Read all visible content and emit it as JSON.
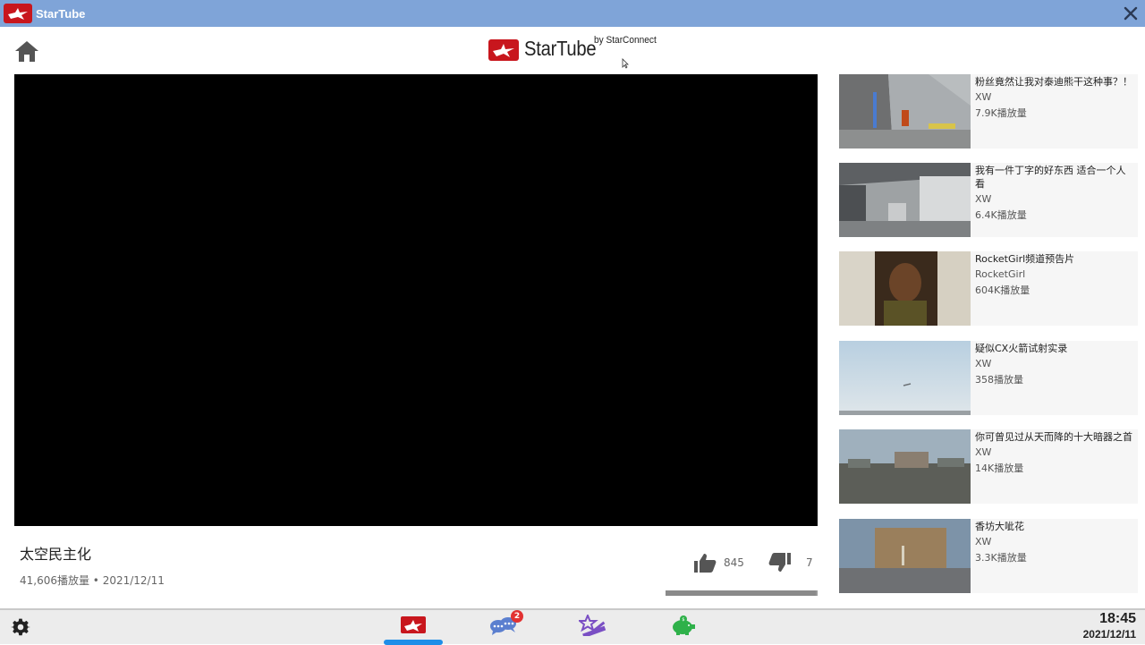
{
  "window": {
    "title": "StarTube"
  },
  "brand": {
    "name": "StarTube",
    "byline": "by StarConnect"
  },
  "video": {
    "title": "太空民主化",
    "meta": "41,606播放量 • 2021/12/11",
    "likes": "845",
    "dislikes": "7",
    "like_ratio": 0.99
  },
  "recommendations": [
    {
      "title": "粉丝竟然让我对泰迪熊干这种事？！",
      "channel": "XW",
      "views": "7.9K播放量"
    },
    {
      "title": "我有一件丁字的好东西 适合一个人看",
      "channel": "XW",
      "views": "6.4K播放量"
    },
    {
      "title": "RocketGirl频道预告片",
      "channel": "RocketGirl",
      "views": "604K播放量"
    },
    {
      "title": "疑似CX火箭试射实录",
      "channel": "XW",
      "views": "358播放量"
    },
    {
      "title": "你可曾见过从天而降的十大暗器之首",
      "channel": "XW",
      "views": "14K播放量"
    },
    {
      "title": "香坊大呲花",
      "channel": "XW",
      "views": "3.3K播放量"
    }
  ],
  "dock": {
    "items": [
      {
        "icon": "startube-icon",
        "active": true
      },
      {
        "icon": "chat-icon",
        "badge": "2"
      },
      {
        "icon": "star-ruler-icon"
      },
      {
        "icon": "piggy-bank-icon"
      }
    ]
  },
  "clock": {
    "time": "18:45",
    "date": "2021/12/11"
  },
  "colors": {
    "titlebar": "#7fa4d8",
    "brand_red": "#c8161d",
    "accent_blue": "#1e8ee8",
    "badge_red": "#e23232"
  }
}
